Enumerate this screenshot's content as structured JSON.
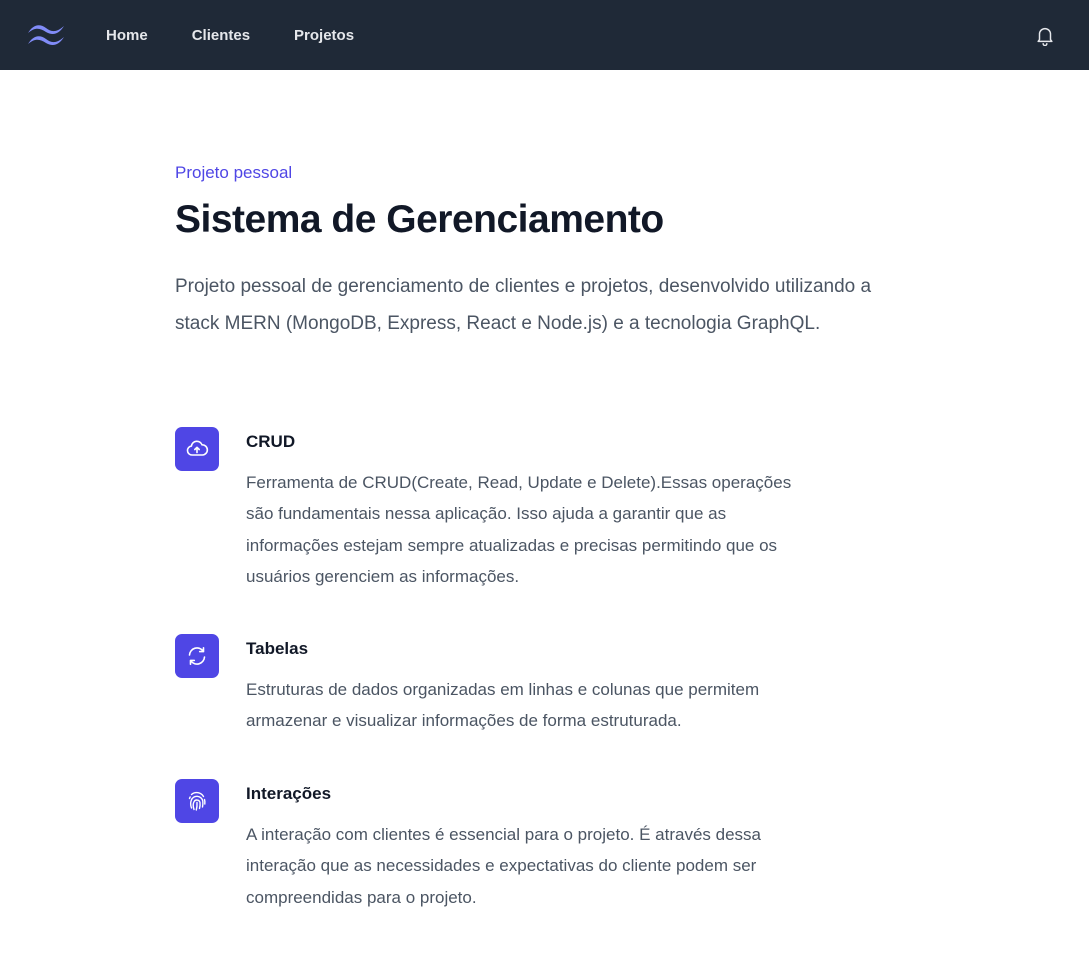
{
  "nav": {
    "logo_icon": "tailwind-wave-logo",
    "links": [
      {
        "label": "Home"
      },
      {
        "label": "Clientes"
      },
      {
        "label": "Projetos"
      }
    ],
    "notification_icon": "bell-icon"
  },
  "hero": {
    "eyebrow": "Projeto pessoal",
    "title": "Sistema de Gerenciamento",
    "description": "Projeto pessoal de gerenciamento de clientes e projetos, desenvolvido utilizando a stack MERN (MongoDB, Express, React e Node.js) e a tecnologia GraphQL."
  },
  "features": [
    {
      "icon": "cloud-upload-icon",
      "title": "CRUD",
      "description": "Ferramenta de CRUD(Create, Read, Update e Delete).Essas operações são fundamentais nessa aplicação. Isso ajuda a garantir que as informações estejam sempre atualizadas e precisas permitindo que os usuários gerenciem as informações."
    },
    {
      "icon": "refresh-icon",
      "title": "Tabelas",
      "description": "Estruturas de dados organizadas em linhas e colunas que permitem armazenar e visualizar informações de forma estruturada."
    },
    {
      "icon": "fingerprint-icon",
      "title": "Interações",
      "description": "A interação com clientes é essencial para o projeto. É através dessa interação que as necessidades e expectativas do cliente podem ser compreendidas para o projeto."
    }
  ],
  "colors": {
    "navbar_bg": "#1f2937",
    "accent": "#4f46e5",
    "logo": "#818cf8"
  }
}
